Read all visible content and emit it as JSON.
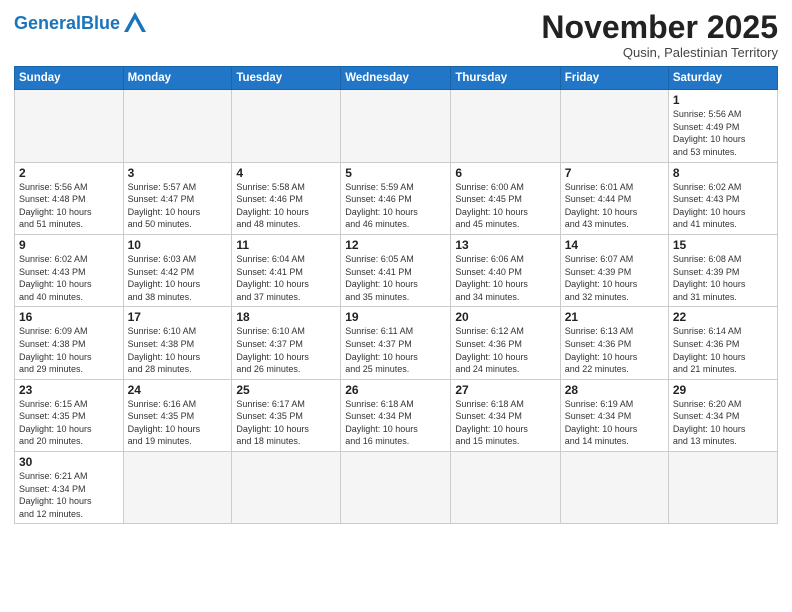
{
  "logo": {
    "text_general": "General",
    "text_blue": "Blue"
  },
  "title": "November 2025",
  "subtitle": "Qusin, Palestinian Territory",
  "days_of_week": [
    "Sunday",
    "Monday",
    "Tuesday",
    "Wednesday",
    "Thursday",
    "Friday",
    "Saturday"
  ],
  "weeks": [
    [
      {
        "day": "",
        "info": ""
      },
      {
        "day": "",
        "info": ""
      },
      {
        "day": "",
        "info": ""
      },
      {
        "day": "",
        "info": ""
      },
      {
        "day": "",
        "info": ""
      },
      {
        "day": "",
        "info": ""
      },
      {
        "day": "1",
        "info": "Sunrise: 5:56 AM\nSunset: 4:49 PM\nDaylight: 10 hours\nand 53 minutes."
      }
    ],
    [
      {
        "day": "2",
        "info": "Sunrise: 5:56 AM\nSunset: 4:48 PM\nDaylight: 10 hours\nand 51 minutes."
      },
      {
        "day": "3",
        "info": "Sunrise: 5:57 AM\nSunset: 4:47 PM\nDaylight: 10 hours\nand 50 minutes."
      },
      {
        "day": "4",
        "info": "Sunrise: 5:58 AM\nSunset: 4:46 PM\nDaylight: 10 hours\nand 48 minutes."
      },
      {
        "day": "5",
        "info": "Sunrise: 5:59 AM\nSunset: 4:46 PM\nDaylight: 10 hours\nand 46 minutes."
      },
      {
        "day": "6",
        "info": "Sunrise: 6:00 AM\nSunset: 4:45 PM\nDaylight: 10 hours\nand 45 minutes."
      },
      {
        "day": "7",
        "info": "Sunrise: 6:01 AM\nSunset: 4:44 PM\nDaylight: 10 hours\nand 43 minutes."
      },
      {
        "day": "8",
        "info": "Sunrise: 6:02 AM\nSunset: 4:43 PM\nDaylight: 10 hours\nand 41 minutes."
      }
    ],
    [
      {
        "day": "9",
        "info": "Sunrise: 6:02 AM\nSunset: 4:43 PM\nDaylight: 10 hours\nand 40 minutes."
      },
      {
        "day": "10",
        "info": "Sunrise: 6:03 AM\nSunset: 4:42 PM\nDaylight: 10 hours\nand 38 minutes."
      },
      {
        "day": "11",
        "info": "Sunrise: 6:04 AM\nSunset: 4:41 PM\nDaylight: 10 hours\nand 37 minutes."
      },
      {
        "day": "12",
        "info": "Sunrise: 6:05 AM\nSunset: 4:41 PM\nDaylight: 10 hours\nand 35 minutes."
      },
      {
        "day": "13",
        "info": "Sunrise: 6:06 AM\nSunset: 4:40 PM\nDaylight: 10 hours\nand 34 minutes."
      },
      {
        "day": "14",
        "info": "Sunrise: 6:07 AM\nSunset: 4:39 PM\nDaylight: 10 hours\nand 32 minutes."
      },
      {
        "day": "15",
        "info": "Sunrise: 6:08 AM\nSunset: 4:39 PM\nDaylight: 10 hours\nand 31 minutes."
      }
    ],
    [
      {
        "day": "16",
        "info": "Sunrise: 6:09 AM\nSunset: 4:38 PM\nDaylight: 10 hours\nand 29 minutes."
      },
      {
        "day": "17",
        "info": "Sunrise: 6:10 AM\nSunset: 4:38 PM\nDaylight: 10 hours\nand 28 minutes."
      },
      {
        "day": "18",
        "info": "Sunrise: 6:10 AM\nSunset: 4:37 PM\nDaylight: 10 hours\nand 26 minutes."
      },
      {
        "day": "19",
        "info": "Sunrise: 6:11 AM\nSunset: 4:37 PM\nDaylight: 10 hours\nand 25 minutes."
      },
      {
        "day": "20",
        "info": "Sunrise: 6:12 AM\nSunset: 4:36 PM\nDaylight: 10 hours\nand 24 minutes."
      },
      {
        "day": "21",
        "info": "Sunrise: 6:13 AM\nSunset: 4:36 PM\nDaylight: 10 hours\nand 22 minutes."
      },
      {
        "day": "22",
        "info": "Sunrise: 6:14 AM\nSunset: 4:36 PM\nDaylight: 10 hours\nand 21 minutes."
      }
    ],
    [
      {
        "day": "23",
        "info": "Sunrise: 6:15 AM\nSunset: 4:35 PM\nDaylight: 10 hours\nand 20 minutes."
      },
      {
        "day": "24",
        "info": "Sunrise: 6:16 AM\nSunset: 4:35 PM\nDaylight: 10 hours\nand 19 minutes."
      },
      {
        "day": "25",
        "info": "Sunrise: 6:17 AM\nSunset: 4:35 PM\nDaylight: 10 hours\nand 18 minutes."
      },
      {
        "day": "26",
        "info": "Sunrise: 6:18 AM\nSunset: 4:34 PM\nDaylight: 10 hours\nand 16 minutes."
      },
      {
        "day": "27",
        "info": "Sunrise: 6:18 AM\nSunset: 4:34 PM\nDaylight: 10 hours\nand 15 minutes."
      },
      {
        "day": "28",
        "info": "Sunrise: 6:19 AM\nSunset: 4:34 PM\nDaylight: 10 hours\nand 14 minutes."
      },
      {
        "day": "29",
        "info": "Sunrise: 6:20 AM\nSunset: 4:34 PM\nDaylight: 10 hours\nand 13 minutes."
      }
    ],
    [
      {
        "day": "30",
        "info": "Sunrise: 6:21 AM\nSunset: 4:34 PM\nDaylight: 10 hours\nand 12 minutes."
      },
      {
        "day": "",
        "info": ""
      },
      {
        "day": "",
        "info": ""
      },
      {
        "day": "",
        "info": ""
      },
      {
        "day": "",
        "info": ""
      },
      {
        "day": "",
        "info": ""
      },
      {
        "day": "",
        "info": ""
      }
    ]
  ]
}
